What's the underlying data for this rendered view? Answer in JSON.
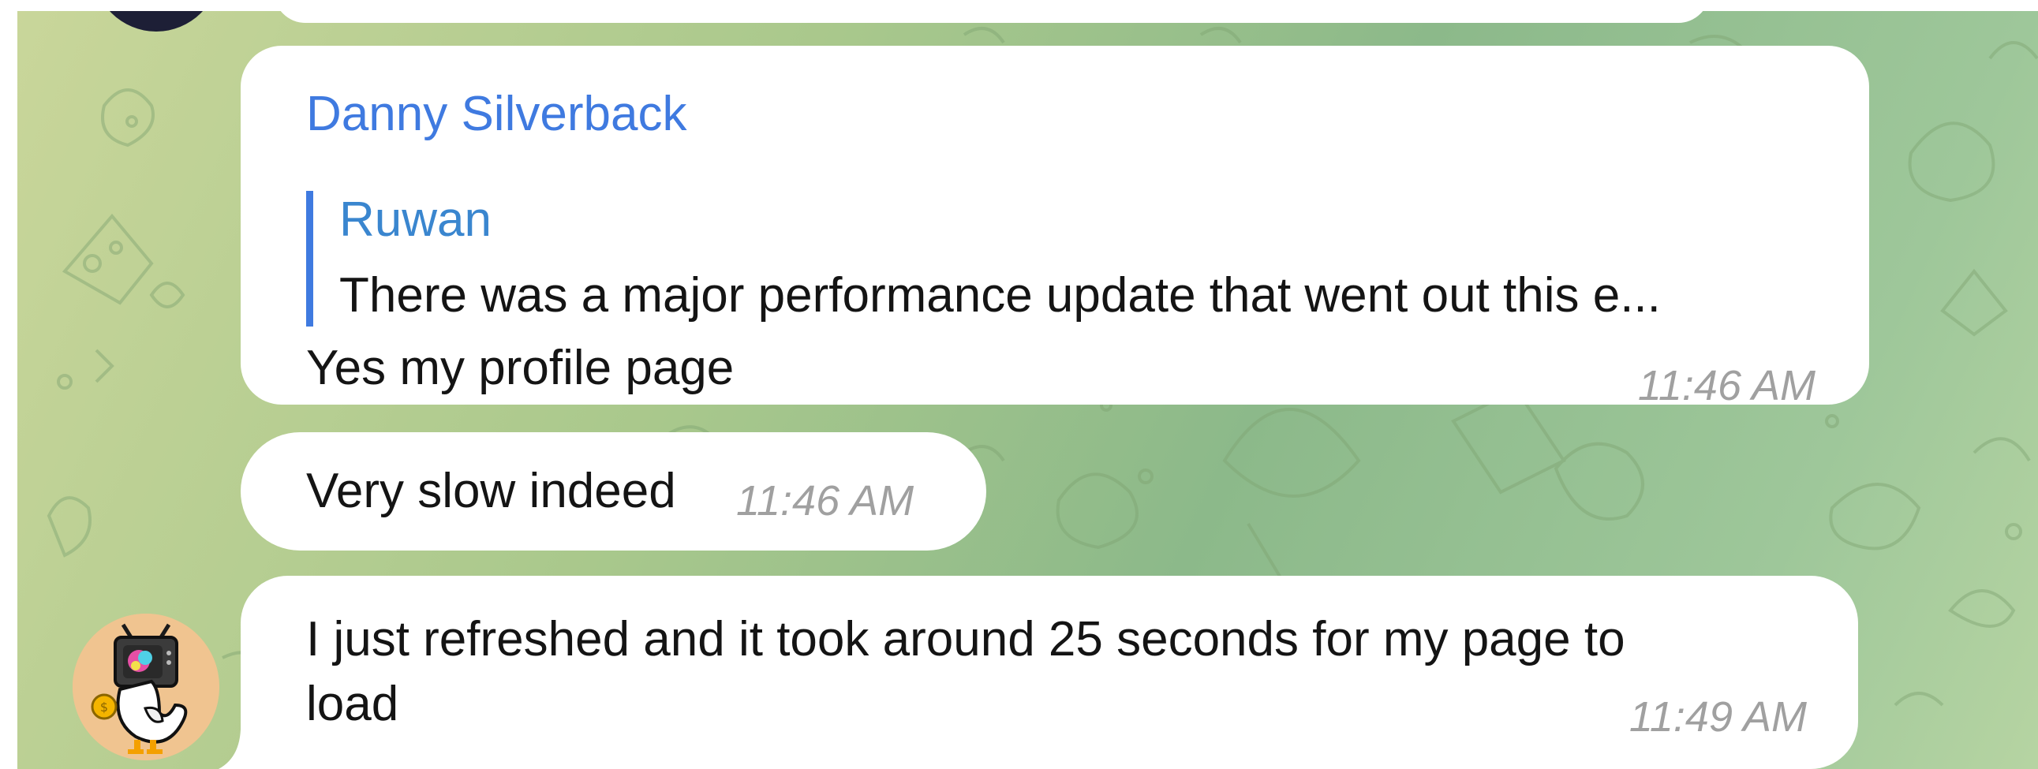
{
  "messages": [
    {
      "sender": "Danny Silverback",
      "reply": {
        "name": "Ruwan",
        "text": "There was a major performance update that went out this e..."
      },
      "text": "Yes my profile page",
      "time": "11:46 AM"
    },
    {
      "text": "Very slow indeed",
      "time": "11:46 AM"
    },
    {
      "text_line1": "I just refreshed and it took around 25 seconds for my page to",
      "text_line2": "load",
      "time": "11:49 AM"
    }
  ],
  "colors": {
    "accent": "#3f7ae0",
    "reply_name": "#3a86cf",
    "bubble": "#ffffff",
    "timestamp": "#a0a0a0"
  },
  "icons": {
    "avatar_bottom": "tv-head-duck-avatar",
    "avatar_top": "user-avatar"
  }
}
